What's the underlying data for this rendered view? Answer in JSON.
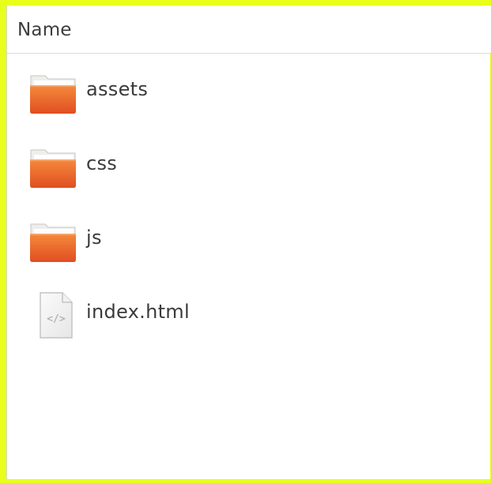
{
  "header": {
    "name_column": "Name"
  },
  "items": [
    {
      "name": "assets",
      "type": "folder",
      "icon": "folder-icon"
    },
    {
      "name": "css",
      "type": "folder",
      "icon": "folder-icon"
    },
    {
      "name": "js",
      "type": "folder",
      "icon": "folder-icon"
    },
    {
      "name": "index.html",
      "type": "file",
      "icon": "html-file-icon"
    }
  ],
  "colors": {
    "highlight_border": "#e8ff1c",
    "folder_orange": "#e8572a",
    "folder_tab": "#f3f1ee"
  }
}
